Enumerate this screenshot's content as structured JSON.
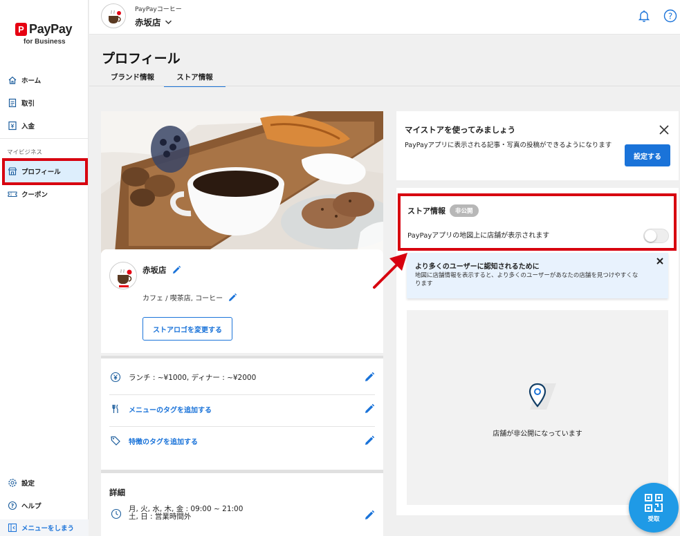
{
  "brand": {
    "logo_text": "PayPay",
    "logo_sub": "for Business",
    "logo_mark": "P"
  },
  "sidebar": {
    "items": [
      {
        "label": "ホーム",
        "icon": "home-icon"
      },
      {
        "label": "取引",
        "icon": "receipt-icon"
      },
      {
        "label": "入金",
        "icon": "deposit-icon"
      }
    ],
    "section_label": "マイビジネス",
    "business_items": [
      {
        "label": "プロフィール",
        "icon": "store-icon",
        "active": true
      },
      {
        "label": "クーポン",
        "icon": "coupon-icon"
      }
    ],
    "bottom_items": [
      {
        "label": "設定",
        "icon": "gear-icon"
      },
      {
        "label": "ヘルプ",
        "icon": "help-icon"
      }
    ],
    "collapse_label": "メニューをしまう"
  },
  "header": {
    "brand_name": "PayPayコーヒー",
    "store_name": "赤坂店"
  },
  "page": {
    "title": "プロフィール",
    "tabs": [
      {
        "label": "ブランド情報",
        "active": false
      },
      {
        "label": "ストア情報",
        "active": true
      }
    ]
  },
  "store_profile": {
    "name": "赤坂店",
    "category": "カフェ / 喫茶店, コーヒー",
    "change_logo_label": "ストアロゴを変更する",
    "price": "ランチ : ~¥1000, ディナー : ~¥2000",
    "menu_tag_link": "メニューのタグを追加する",
    "feature_tag_link": "特徴のタグを追加する",
    "detail_title": "詳細",
    "hours_line1": "月, 火, 水, 木, 金 : 09:00 ~ 21:00",
    "hours_line2": "土, 日 : 営業時間外"
  },
  "mystore": {
    "title": "マイストアを使ってみましょう",
    "description": "PayPayアプリに表示される記事・写真の投稿ができるようになります",
    "button": "設定する"
  },
  "store_info": {
    "title": "ストア情報",
    "badge": "非公開",
    "description": "PayPayアプリの地図上に店舗が表示されます",
    "toggle_on": false
  },
  "tip": {
    "title": "より多くのユーザーに認知されるために",
    "description": "地図に店舗情報を表示すると、より多くのユーザーがあなたの店舗を見つけやすくなります"
  },
  "map": {
    "status_text": "店舗が非公開になっています"
  },
  "fab": {
    "label": "受取"
  },
  "colors": {
    "accent": "#1a73d9",
    "highlight": "#d7000f",
    "brand_red": "#e60012"
  }
}
